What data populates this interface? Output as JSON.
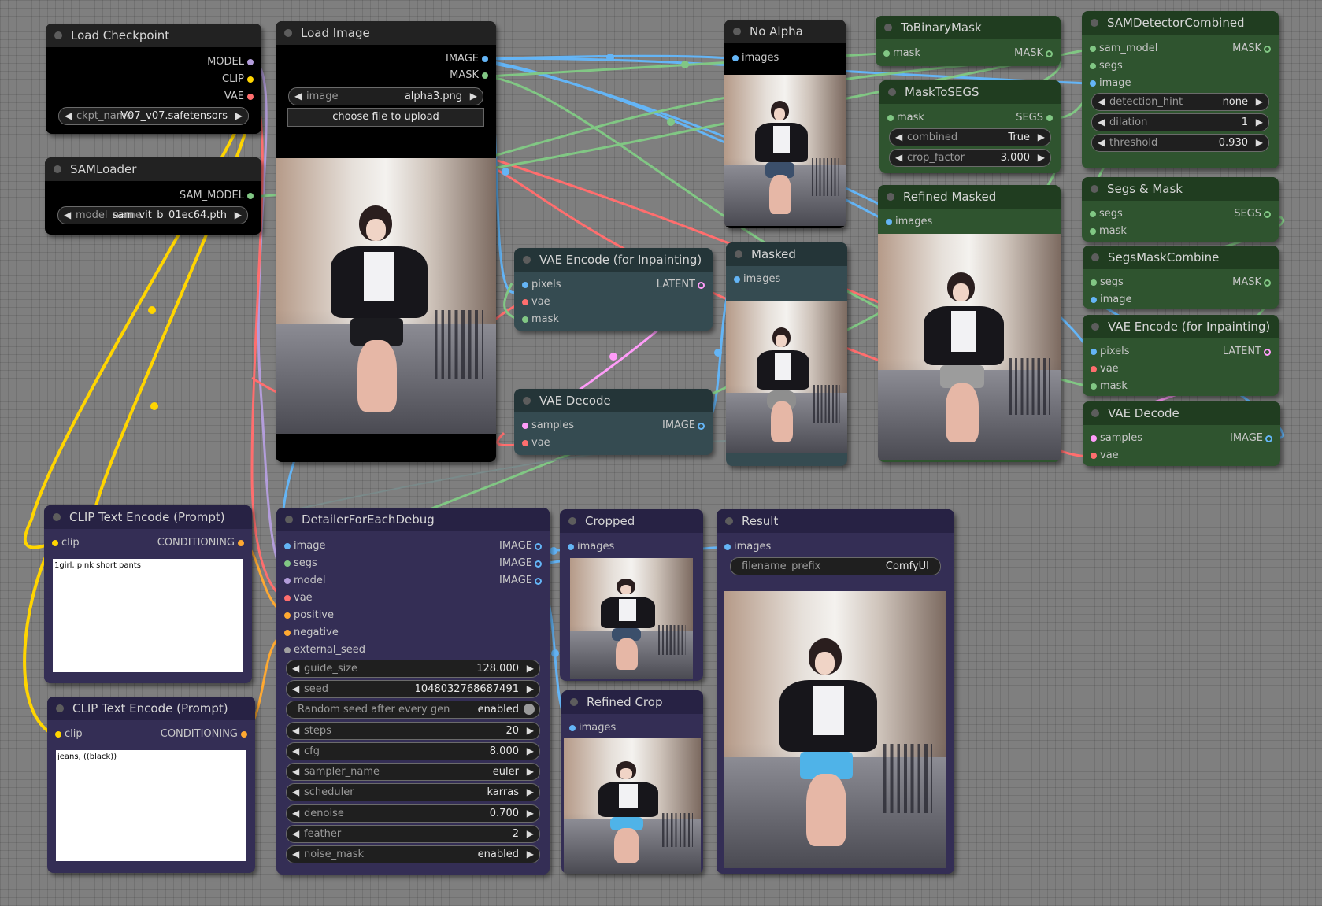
{
  "nodes": {
    "load_checkpoint": {
      "title": "Load Checkpoint",
      "outputs": [
        "MODEL",
        "CLIP",
        "VAE"
      ],
      "widget": {
        "label": "ckpt_name",
        "value": "V07_v07.safetensors"
      }
    },
    "sam_loader": {
      "title": "SAMLoader",
      "outputs": [
        "SAM_MODEL"
      ],
      "widget": {
        "label": "model_name",
        "value": "sam_vit_b_01ec64.pth"
      }
    },
    "load_image": {
      "title": "Load Image",
      "outputs": [
        "IMAGE",
        "MASK"
      ],
      "widget": {
        "label": "image",
        "value": "alpha3.png"
      },
      "button": "choose file to upload"
    },
    "no_alpha": {
      "title": "No Alpha",
      "inputs": [
        "images"
      ]
    },
    "to_binary_mask": {
      "title": "ToBinaryMask",
      "inputs": [
        "mask"
      ],
      "outputs": [
        "MASK"
      ]
    },
    "mask_to_segs": {
      "title": "MaskToSEGS",
      "inputs": [
        "mask"
      ],
      "outputs": [
        "SEGS"
      ],
      "widgets": [
        {
          "label": "combined",
          "value": "True"
        },
        {
          "label": "crop_factor",
          "value": "3.000"
        }
      ]
    },
    "sam_detector": {
      "title": "SAMDetectorCombined",
      "inputs": [
        "sam_model",
        "segs",
        "image"
      ],
      "outputs": [
        "MASK"
      ],
      "widgets": [
        {
          "label": "detection_hint",
          "value": "none"
        },
        {
          "label": "dilation",
          "value": "1"
        },
        {
          "label": "threshold",
          "value": "0.930"
        }
      ]
    },
    "segs_and_mask": {
      "title": "Segs & Mask",
      "inputs": [
        "segs",
        "mask"
      ],
      "outputs": [
        "SEGS"
      ]
    },
    "segs_mask_combine": {
      "title": "SegsMaskCombine",
      "inputs": [
        "segs",
        "image"
      ],
      "outputs": [
        "MASK"
      ]
    },
    "vae_encode_right": {
      "title": "VAE Encode (for Inpainting)",
      "inputs": [
        "pixels",
        "vae",
        "mask"
      ],
      "outputs": [
        "LATENT"
      ]
    },
    "vae_decode_right": {
      "title": "VAE Decode",
      "inputs": [
        "samples",
        "vae"
      ],
      "outputs": [
        "IMAGE"
      ]
    },
    "refined_masked": {
      "title": "Refined Masked",
      "inputs": [
        "images"
      ]
    },
    "vae_encode_mid": {
      "title": "VAE Encode (for Inpainting)",
      "inputs": [
        "pixels",
        "vae",
        "mask"
      ],
      "outputs": [
        "LATENT"
      ]
    },
    "vae_decode_mid": {
      "title": "VAE Decode",
      "inputs": [
        "samples",
        "vae"
      ],
      "outputs": [
        "IMAGE"
      ]
    },
    "masked": {
      "title": "Masked",
      "inputs": [
        "images"
      ]
    },
    "clip_pos": {
      "title": "CLIP Text Encode (Prompt)",
      "inputs": [
        "clip"
      ],
      "outputs": [
        "CONDITIONING"
      ],
      "text": "1girl, pink short pants"
    },
    "clip_neg": {
      "title": "CLIP Text Encode (Prompt)",
      "inputs": [
        "clip"
      ],
      "outputs": [
        "CONDITIONING"
      ],
      "text": "jeans, ((black))"
    },
    "detailer": {
      "title": "DetailerForEachDebug",
      "inputs": [
        "image",
        "segs",
        "model",
        "vae",
        "positive",
        "negative",
        "external_seed"
      ],
      "outputs": [
        "IMAGE",
        "IMAGE",
        "IMAGE"
      ],
      "widgets": [
        {
          "label": "guide_size",
          "value": "128.000"
        },
        {
          "label": "seed",
          "value": "1048032768687491"
        },
        {
          "label": "Random seed after every gen",
          "value": "enabled",
          "toggle": true
        },
        {
          "label": "steps",
          "value": "20"
        },
        {
          "label": "cfg",
          "value": "8.000"
        },
        {
          "label": "sampler_name",
          "value": "euler"
        },
        {
          "label": "scheduler",
          "value": "karras"
        },
        {
          "label": "denoise",
          "value": "0.700"
        },
        {
          "label": "feather",
          "value": "2"
        },
        {
          "label": "noise_mask",
          "value": "enabled"
        }
      ]
    },
    "cropped": {
      "title": "Cropped",
      "inputs": [
        "images"
      ]
    },
    "refined_crop": {
      "title": "Refined Crop",
      "inputs": [
        "images"
      ]
    },
    "result": {
      "title": "Result",
      "inputs": [
        "images"
      ],
      "widget": {
        "label": "filename_prefix",
        "value": "ComfyUI"
      }
    }
  },
  "colors": {
    "model": "#b39ddb",
    "clip": "#ffd500",
    "vae": "#ff6e6e",
    "image": "#64b5f6",
    "mask": "#81c784",
    "latent": "#ff9cf9",
    "conditioning": "#ffa931",
    "sam_model": "#81c784",
    "segs": "#81c784",
    "seed": "#a0a0a0"
  }
}
